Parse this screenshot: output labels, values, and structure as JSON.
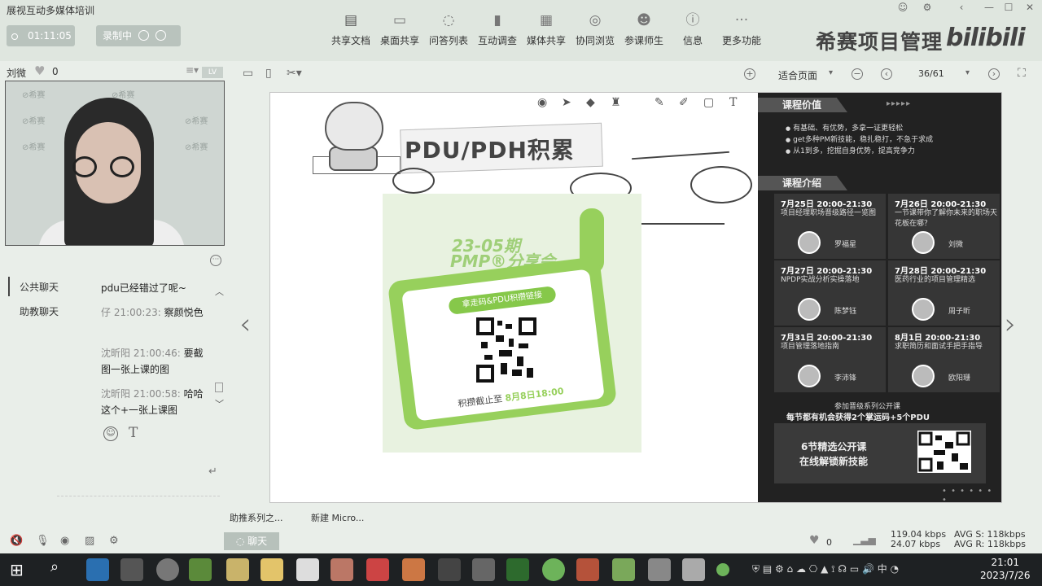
{
  "app": {
    "title": "展视互动多媒体培训"
  },
  "window_controls": [
    "☺",
    "⚙",
    "‹",
    "—",
    "☐",
    "✕"
  ],
  "session": {
    "timer": "01:11:05",
    "recording_label": "录制中"
  },
  "toolbar": [
    {
      "label": "共享文档",
      "icon": "share-doc-icon",
      "glyph": "▤"
    },
    {
      "label": "桌面共享",
      "icon": "desktop-share-icon",
      "glyph": "▭"
    },
    {
      "label": "问答列表",
      "icon": "qa-icon",
      "glyph": "◌"
    },
    {
      "label": "互动调查",
      "icon": "survey-icon",
      "glyph": "▮"
    },
    {
      "label": "媒体共享",
      "icon": "media-icon",
      "glyph": "▦"
    },
    {
      "label": "协同浏览",
      "icon": "browse-icon",
      "glyph": "◎"
    },
    {
      "label": "参课师生",
      "icon": "people-icon",
      "glyph": "☻"
    },
    {
      "label": "信息",
      "icon": "info-icon",
      "glyph": "ⓘ"
    },
    {
      "label": "更多功能",
      "icon": "more-icon",
      "glyph": "···"
    }
  ],
  "brand": {
    "text": "希赛项目管理",
    "logo": "bilibili"
  },
  "user": {
    "name": "刘微",
    "likes": "0",
    "level": "LV"
  },
  "chat": {
    "tabs": [
      "公共聊天",
      "助教聊天"
    ],
    "messages": [
      {
        "meta": "",
        "text": "pdu已经错过了呢~"
      },
      {
        "meta": "仔 21:00:23:",
        "text": "察颜悦色"
      },
      {
        "meta": "沈昕阳 21:00:46:",
        "text": "要截图一张上课的图"
      },
      {
        "meta": "沈昕阳 21:00:58:",
        "text": "哈哈 这个+一张上课图"
      }
    ]
  },
  "document": {
    "zoom": "适合页面",
    "page": "36/61"
  },
  "slide": {
    "title": "PDU/PDH积累",
    "poster_line1": "23-05期",
    "poster_line2": "PMP®分享会",
    "pill": "拿走码&PDU积攒链接",
    "deadline_prefix": "积攒截止至",
    "deadline_date": "8月8日18:00"
  },
  "schedule": {
    "value_tag": "课程价值",
    "values": [
      "有基础、有优势，多拿一证更轻松",
      "get多种PM新技能，稳扎稳打，不急于求成",
      "从1到多，挖掘自身优势，提高竞争力"
    ],
    "intro_tag": "课程介绍",
    "sessions": [
      {
        "time": "7月25日  20:00-21:30",
        "desc": "项目经理职场晋级路径一览图",
        "teacher": "罗福星"
      },
      {
        "time": "7月26日  20:00-21:30",
        "desc": "一节课带你了解你未来的职场天花板在哪？",
        "teacher": "刘微"
      },
      {
        "time": "7月27日  20:00-21:30",
        "desc": "NPDP实战分析实操落地",
        "teacher": "陈梦钰"
      },
      {
        "time": "7月28日  20:00-21:30",
        "desc": "医药行业的项目管理精选",
        "teacher": "周子昕"
      },
      {
        "time": "7月31日  20:00-21:30",
        "desc": "项目管理落地指南",
        "teacher": "李沛锋"
      },
      {
        "time": "8月1日  20:00-21:30",
        "desc": "求职简历和面试手把手指导",
        "teacher": "欧阳珊"
      }
    ],
    "pdu_line1": "参加晋级系列公开课",
    "pdu_line2": "每节都有机会获得2个掌运码+5个PDU",
    "promo_line1": "6节精选公开课",
    "promo_line2": "在线解锁新技能"
  },
  "bottom": {
    "doc_labels": [
      "助推系列之...",
      "新建 Micro..."
    ],
    "chat_button": "聊天",
    "likes": "0",
    "rate_up": "119.04 kbps",
    "rate_down": "24.07 kbps",
    "avg_s": "AVG S: 118kbps",
    "avg_r": "AVG R: 118kbps"
  },
  "taskbar": {
    "time": "21:01",
    "date": "2023/7/26",
    "ime": "中",
    "tray_icons": [
      "shield-icon",
      "network-icon",
      "volume-icon"
    ]
  },
  "colors": {
    "accent_green": "#97d05c",
    "panel_dark": "#222222"
  }
}
